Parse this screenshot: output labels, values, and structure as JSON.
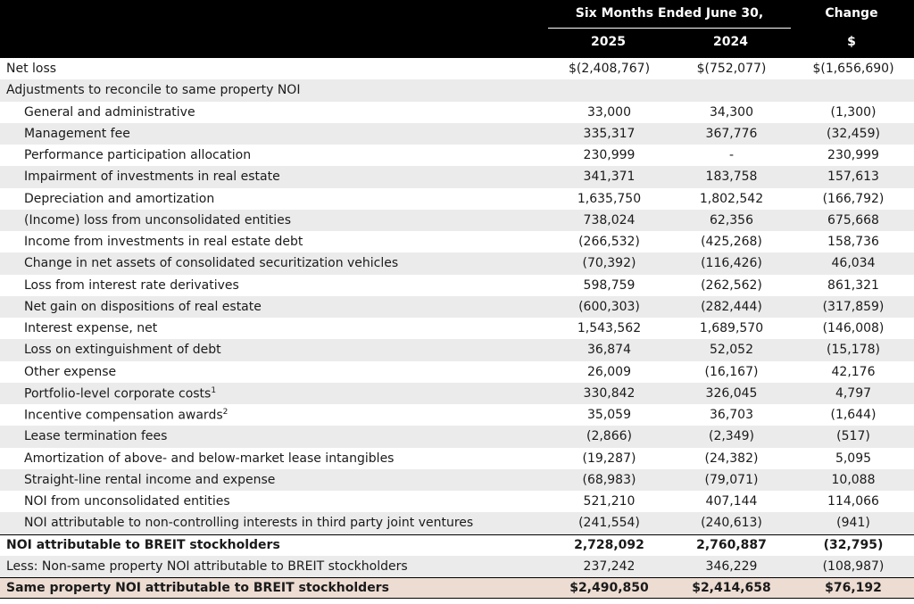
{
  "header": {
    "group_label": "Six Months Ended June 30,",
    "change_label": "Change",
    "col_2025": "2025",
    "col_2024": "2024",
    "col_change_unit": "$"
  },
  "rows": [
    {
      "label": "Net loss",
      "sup": "",
      "v2025": "$(2,408,767)",
      "v2024": "$(752,077)",
      "change": "$(1,656,690)"
    },
    {
      "label": "Adjustments to reconcile to same property NOI",
      "sup": "",
      "v2025": "",
      "v2024": "",
      "change": ""
    },
    {
      "label": "General and administrative",
      "sup": "",
      "v2025": "33,000",
      "v2024": "34,300",
      "change": "(1,300)"
    },
    {
      "label": "Management fee",
      "sup": "",
      "v2025": "335,317",
      "v2024": "367,776",
      "change": "(32,459)"
    },
    {
      "label": "Performance participation allocation",
      "sup": "",
      "v2025": "230,999",
      "v2024": "-",
      "change": "230,999"
    },
    {
      "label": "Impairment of investments in real estate",
      "sup": "",
      "v2025": "341,371",
      "v2024": "183,758",
      "change": "157,613"
    },
    {
      "label": "Depreciation and amortization",
      "sup": "",
      "v2025": "1,635,750",
      "v2024": "1,802,542",
      "change": "(166,792)"
    },
    {
      "label": "(Income) loss from unconsolidated entities",
      "sup": "",
      "v2025": "738,024",
      "v2024": "62,356",
      "change": "675,668"
    },
    {
      "label": "Income from investments in real estate debt",
      "sup": "",
      "v2025": "(266,532)",
      "v2024": "(425,268)",
      "change": "158,736"
    },
    {
      "label": "Change in net assets of consolidated securitization vehicles",
      "sup": "",
      "v2025": "(70,392)",
      "v2024": "(116,426)",
      "change": "46,034"
    },
    {
      "label": "Loss from interest rate derivatives",
      "sup": "",
      "v2025": "598,759",
      "v2024": "(262,562)",
      "change": "861,321"
    },
    {
      "label": "Net gain on dispositions of real estate",
      "sup": "",
      "v2025": "(600,303)",
      "v2024": "(282,444)",
      "change": "(317,859)"
    },
    {
      "label": "Interest expense, net",
      "sup": "",
      "v2025": "1,543,562",
      "v2024": "1,689,570",
      "change": "(146,008)"
    },
    {
      "label": "Loss on extinguishment of debt",
      "sup": "",
      "v2025": "36,874",
      "v2024": "52,052",
      "change": "(15,178)"
    },
    {
      "label": "Other expense",
      "sup": "",
      "v2025": "26,009",
      "v2024": "(16,167)",
      "change": "42,176"
    },
    {
      "label": "Portfolio-level corporate costs",
      "sup": "1",
      "v2025": "330,842",
      "v2024": "326,045",
      "change": "4,797"
    },
    {
      "label": "Incentive compensation awards",
      "sup": "2",
      "v2025": "35,059",
      "v2024": "36,703",
      "change": "(1,644)"
    },
    {
      "label": "Lease termination fees",
      "sup": "",
      "v2025": "(2,866)",
      "v2024": "(2,349)",
      "change": "(517)"
    },
    {
      "label": "Amortization of above- and below-market lease intangibles",
      "sup": "",
      "v2025": "(19,287)",
      "v2024": "(24,382)",
      "change": "5,095"
    },
    {
      "label": "Straight-line rental income and expense",
      "sup": "",
      "v2025": "(68,983)",
      "v2024": "(79,071)",
      "change": "10,088"
    },
    {
      "label": "NOI from unconsolidated entities",
      "sup": "",
      "v2025": "521,210",
      "v2024": "407,144",
      "change": "114,066"
    },
    {
      "label": "NOI attributable to non-controlling interests in third party joint ventures",
      "sup": "",
      "v2025": "(241,554)",
      "v2024": "(240,613)",
      "change": "(941)"
    },
    {
      "label": "NOI attributable to BREIT stockholders",
      "sup": "",
      "v2025": "2,728,092",
      "v2024": "2,760,887",
      "change": "(32,795)"
    },
    {
      "label": "Less: Non-same property NOI attributable to BREIT stockholders",
      "sup": "",
      "v2025": "237,242",
      "v2024": "346,229",
      "change": "(108,987)"
    },
    {
      "label": "Same property NOI attributable to BREIT stockholders",
      "sup": "",
      "v2025": "$2,490,850",
      "v2024": "$2,414,658",
      "change": "$76,192"
    }
  ]
}
